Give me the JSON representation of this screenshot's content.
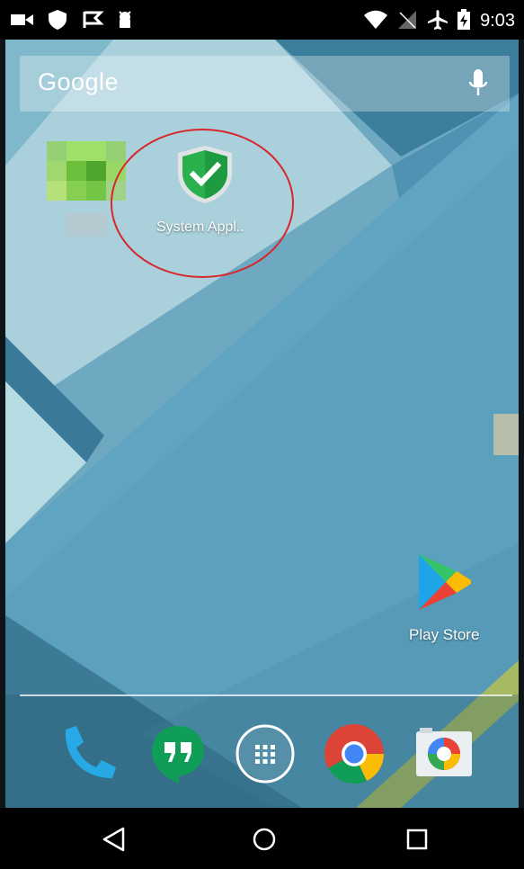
{
  "status_bar": {
    "time": "9:03",
    "left_icons": [
      "video-camera-icon",
      "shield-icon",
      "flag-check-icon",
      "android-debug-icon"
    ],
    "right_icons": [
      "wifi-icon",
      "no-signal-icon",
      "airplane-mode-icon",
      "battery-charging-icon"
    ]
  },
  "search_bar": {
    "label": "Google",
    "icon": "microphone-icon"
  },
  "home_icons": [
    {
      "label": "",
      "icon": "pixelated-app-icon"
    },
    {
      "label": "System Appl..",
      "icon": "shield-check-icon",
      "annotation": "red circle highlight"
    },
    {
      "label": "Play Store",
      "icon": "play-store-icon"
    }
  ],
  "dock": [
    "phone-icon",
    "hangouts-icon",
    "app-drawer-icon",
    "chrome-icon",
    "camera-icon"
  ],
  "nav_bar": [
    "back-icon",
    "home-icon",
    "recents-icon"
  ],
  "colors": {
    "wallpaper_main": "#5ba0bd",
    "annotation_red": "#d8262c",
    "shield_green": "#2bb04e"
  }
}
